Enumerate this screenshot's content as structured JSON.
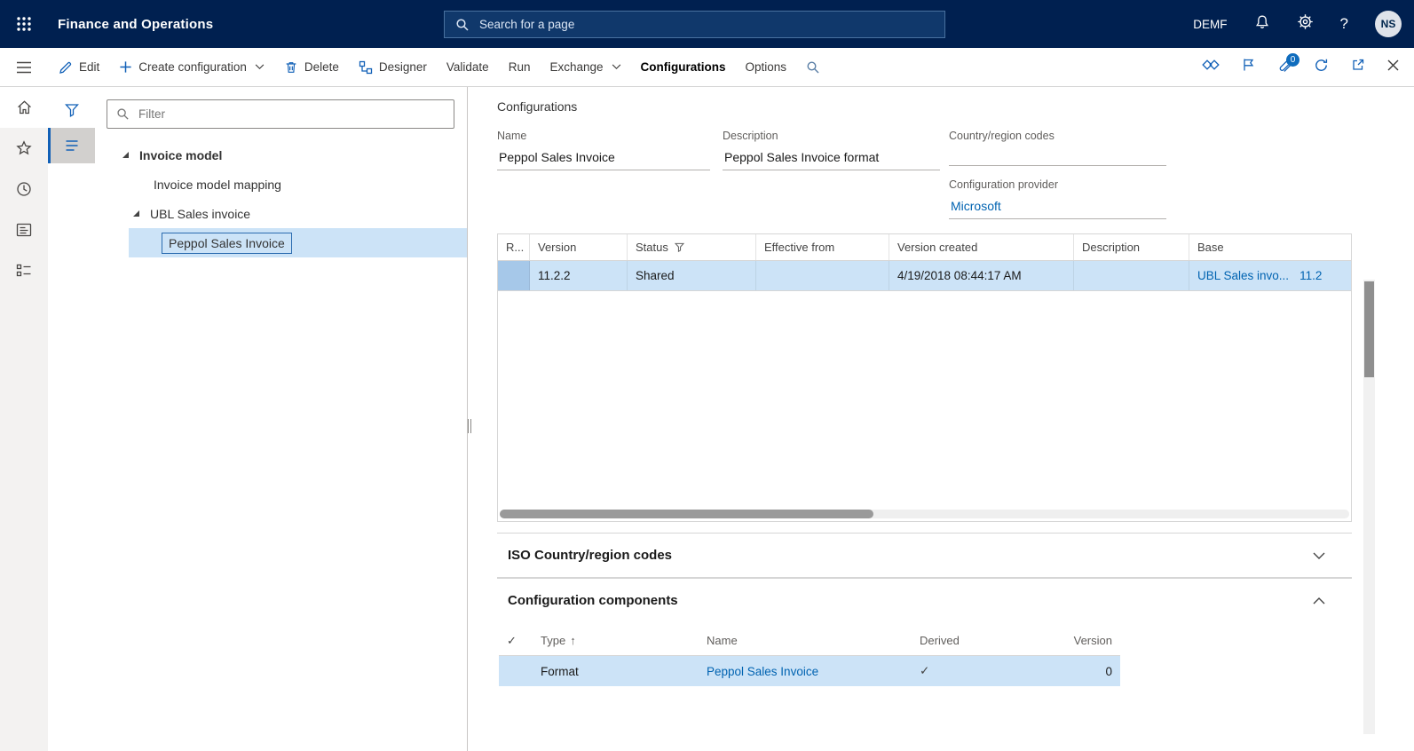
{
  "colors": {
    "topbar_bg": "#002050",
    "accent": "#1160b7",
    "link": "#0063b1",
    "selection": "#cce3f7",
    "rail_bg": "#f3f2f1"
  },
  "topbar": {
    "app_title": "Finance and Operations",
    "search_placeholder": "Search for a page",
    "company_badge": "DEMF",
    "help_label": "?",
    "avatar_initials": "NS"
  },
  "action_bar": {
    "edit": "Edit",
    "create_configuration": "Create configuration",
    "delete": "Delete",
    "designer": "Designer",
    "validate": "Validate",
    "run": "Run",
    "exchange": "Exchange",
    "configurations_tab": "Configurations",
    "options_tab": "Options",
    "attachments_badge": "0"
  },
  "left_panel": {
    "filter_placeholder": "Filter",
    "tree": [
      {
        "label": "Invoice model"
      },
      {
        "label": "Invoice model mapping"
      },
      {
        "label": "UBL Sales invoice"
      },
      {
        "label": "Peppol Sales Invoice"
      }
    ]
  },
  "main": {
    "page_caption": "Configurations",
    "fields": {
      "name_label": "Name",
      "name_value": "Peppol Sales Invoice",
      "description_label": "Description",
      "description_value": "Peppol Sales Invoice format",
      "country_region_label": "Country/region codes",
      "country_region_value": "",
      "provider_label": "Configuration provider",
      "provider_value": "Microsoft"
    },
    "versions_grid": {
      "headers": {
        "repository": "R...",
        "version": "Version",
        "status": "Status",
        "effective_from": "Effective from",
        "version_created": "Version created",
        "description": "Description",
        "base": "Base"
      },
      "row": {
        "version": "11.2.2",
        "status": "Shared",
        "effective_from": "",
        "version_created": "4/19/2018 08:44:17 AM",
        "description": "",
        "base_link": "UBL Sales invo...",
        "base_version": "11.2"
      }
    },
    "iso_section_title": "ISO Country/region codes",
    "components_section_title": "Configuration components",
    "components_grid": {
      "headers": {
        "type": "Type",
        "name": "Name",
        "derived": "Derived",
        "version": "Version"
      },
      "row": {
        "type": "Format",
        "name": "Peppol Sales Invoice",
        "derived": "✓",
        "version": "0"
      }
    }
  },
  "icons": {
    "sort_asc": "↑",
    "check": "✓"
  }
}
